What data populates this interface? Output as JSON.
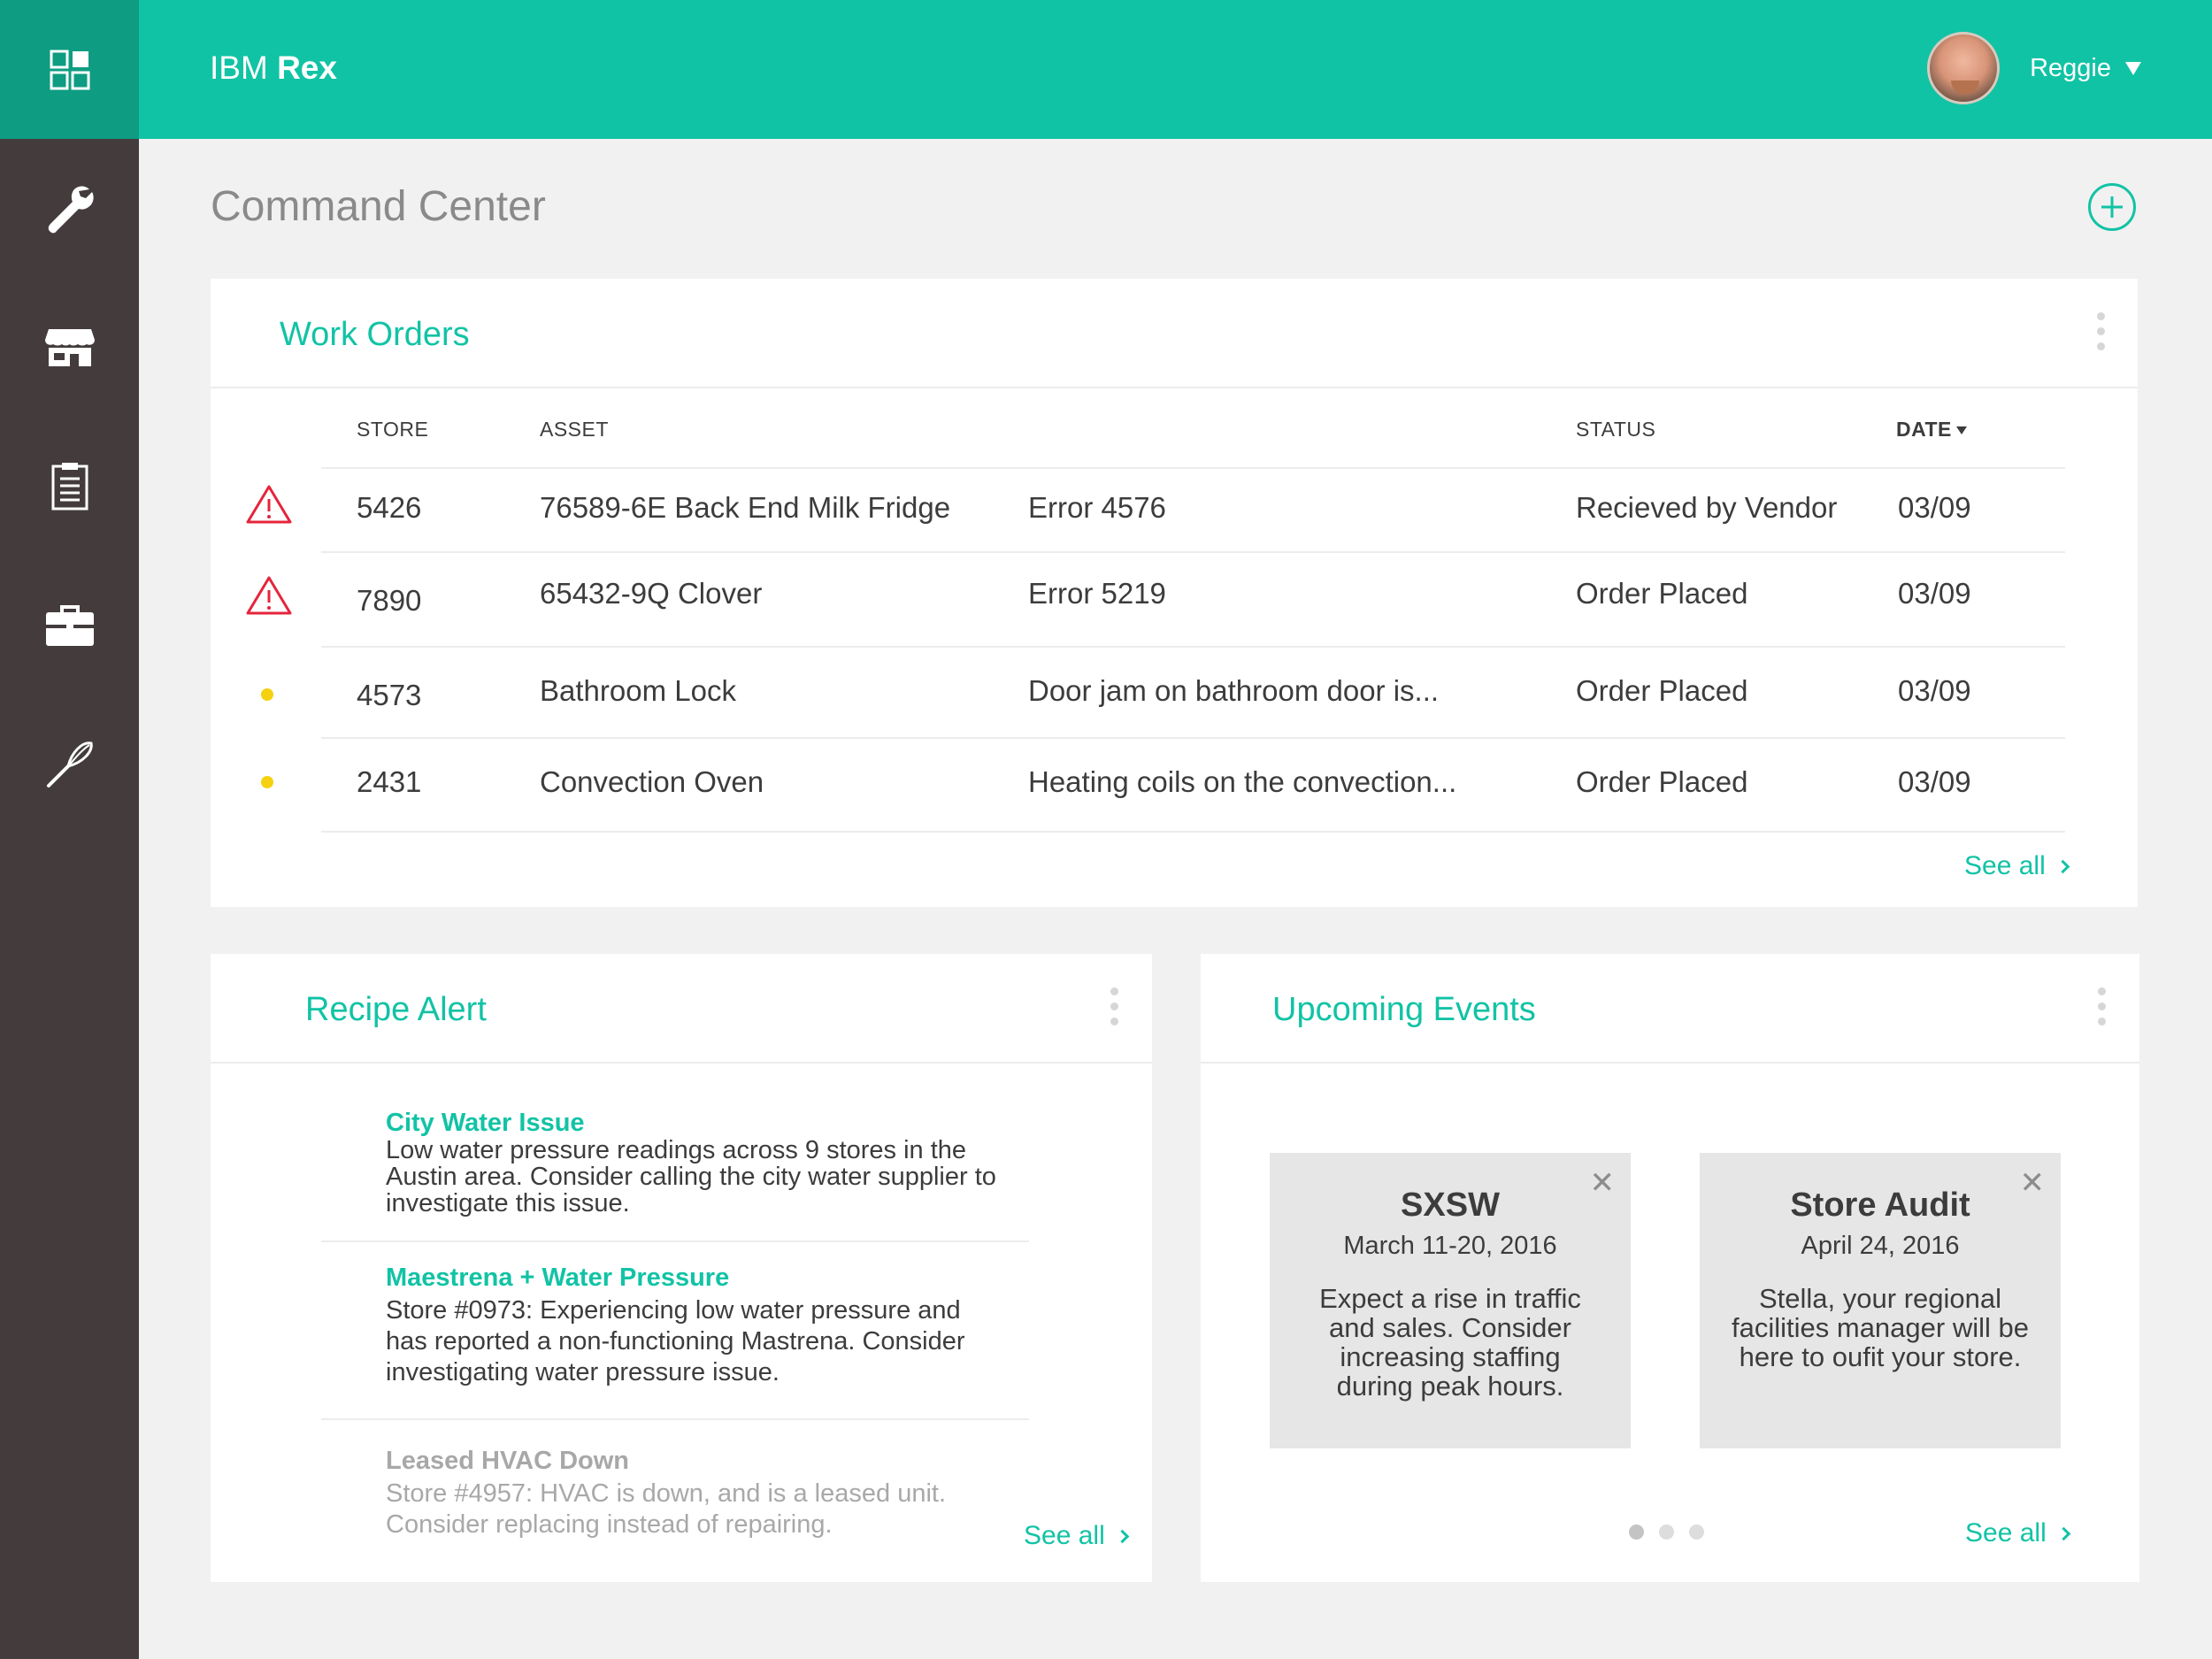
{
  "app": {
    "brand_light": "IBM ",
    "brand_bold": "Rex"
  },
  "user": {
    "name": "Reggie"
  },
  "sidebar": {
    "items": [
      {
        "icon": "dashboard-icon"
      },
      {
        "icon": "wrench-icon"
      },
      {
        "icon": "store-icon"
      },
      {
        "icon": "clipboard-icon"
      },
      {
        "icon": "briefcase-icon"
      },
      {
        "icon": "whisk-icon"
      }
    ]
  },
  "page": {
    "title": "Command Center"
  },
  "colors": {
    "accent": "#11c3a5",
    "accent_dark": "#0e9c82",
    "sidebar": "#443c3c",
    "warning": "#e5243b",
    "caution": "#f5d10f"
  },
  "work_orders": {
    "title": "Work Orders",
    "columns": {
      "store": "STORE",
      "asset": "ASSET",
      "status": "STATUS",
      "date": "DATE"
    },
    "rows": [
      {
        "severity": "warning",
        "store": "5426",
        "asset": "76589-6E Back End Milk Fridge",
        "issue": "Error 4576",
        "status": "Recieved by Vendor",
        "date": "03/09"
      },
      {
        "severity": "warning",
        "store": "7890",
        "asset": "65432-9Q Clover",
        "issue": "Error 5219",
        "status": "Order Placed",
        "date": "03/09"
      },
      {
        "severity": "caution",
        "store": "4573",
        "asset": "Bathroom Lock",
        "issue": "Door jam on bathroom door is...",
        "status": "Order Placed",
        "date": "03/09"
      },
      {
        "severity": "caution",
        "store": "2431",
        "asset": "Convection Oven",
        "issue": "Heating coils on the convection...",
        "status": "Order Placed",
        "date": "03/09"
      }
    ],
    "see_all": "See all"
  },
  "recipe_alert": {
    "title": "Recipe Alert",
    "alerts": [
      {
        "title": "City Water Issue",
        "body": "Low water pressure readings across 9 stores in the Austin area. Consider calling the city water supplier to investigate this issue."
      },
      {
        "title": "Maestrena + Water Pressure",
        "body": "Store #0973: Experiencing low water pressure and has reported a non-functioning Mastrena. Consider investigating water pressure issue."
      },
      {
        "title": "Leased HVAC Down",
        "body": "Store #4957: HVAC is down, and is a leased unit. Consider replacing instead of repairing."
      }
    ],
    "see_all": "See all"
  },
  "upcoming_events": {
    "title": "Upcoming Events",
    "events": [
      {
        "title": "SXSW",
        "date": "March 11-20, 2016",
        "desc": "Expect a rise in traffic and sales. Consider increasing staffing during peak hours."
      },
      {
        "title": "Store Audit",
        "date": "April 24, 2016",
        "desc": "Stella, your regional facilities manager will be here to oufit your store."
      }
    ],
    "carousel_pages": 3,
    "carousel_active": 1,
    "see_all": "See all"
  }
}
